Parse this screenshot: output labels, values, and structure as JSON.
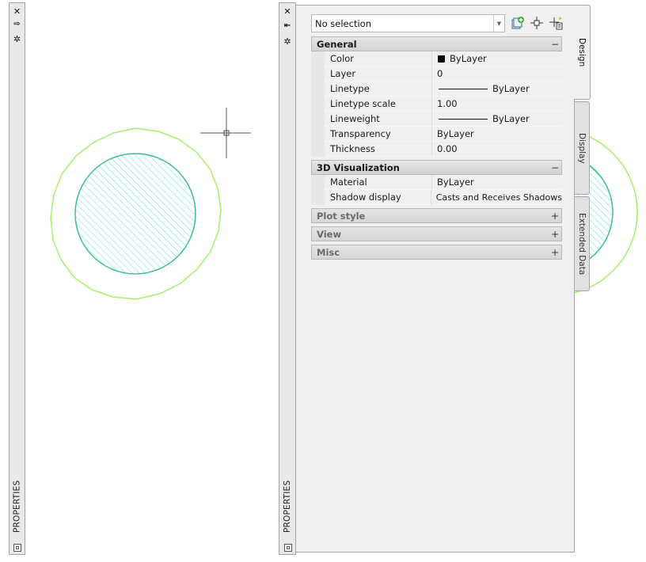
{
  "left_palette": {
    "title": "PROPERTIES",
    "controls": {
      "close": "✕",
      "autohide": "⇨",
      "properties": "✲"
    }
  },
  "palette": {
    "title": "PROPERTIES",
    "controls": {
      "close": "✕",
      "autohide": "⇤",
      "properties": "✲"
    }
  },
  "selection": {
    "value": "No selection"
  },
  "sections": {
    "general": {
      "label": "General",
      "toggle": "−",
      "rows": [
        {
          "name": "Color",
          "value": "ByLayer"
        },
        {
          "name": "Layer",
          "value": "0"
        },
        {
          "name": "Linetype",
          "value": "ByLayer"
        },
        {
          "name": "Linetype scale",
          "value": "1.00"
        },
        {
          "name": "Lineweight",
          "value": "ByLayer"
        },
        {
          "name": "Transparency",
          "value": "ByLayer"
        },
        {
          "name": "Thickness",
          "value": "0.00"
        }
      ]
    },
    "viz3d": {
      "label": "3D Visualization",
      "toggle": "−",
      "rows": [
        {
          "name": "Material",
          "value": "ByLayer"
        },
        {
          "name": "Shadow display",
          "value": "Casts and Receives Shadows"
        }
      ]
    },
    "plot_style": {
      "label": "Plot style",
      "toggle": "+"
    },
    "view": {
      "label": "View",
      "toggle": "+"
    },
    "misc": {
      "label": "Misc",
      "toggle": "+"
    }
  },
  "tabs": {
    "design": "Design",
    "display": "Display",
    "extended": "Extended Data"
  },
  "colors": {
    "outer_circle": "#a6f06a",
    "hatch_line": "#5fe3e0",
    "hatch_border": "#3fbf8f"
  }
}
